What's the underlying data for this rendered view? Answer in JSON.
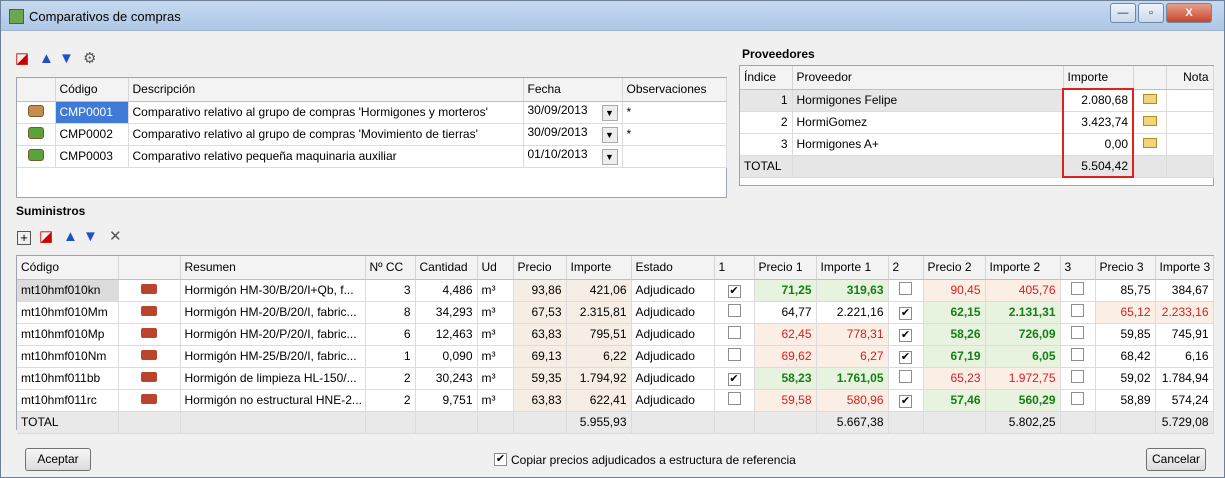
{
  "window": {
    "title": "Comparativos de compras",
    "minimize": "—",
    "maximize": "▫",
    "close": "X"
  },
  "comparativos": {
    "headers": {
      "codigo": "Código",
      "descripcion": "Descripción",
      "fecha": "Fecha",
      "observaciones": "Observaciones"
    },
    "rows": [
      {
        "codigo": "CMP0001",
        "descripcion": "Comparativo relativo al grupo de compras 'Hormigones y morteros'",
        "fecha": "30/09/2013",
        "obs": "*"
      },
      {
        "codigo": "CMP0002",
        "descripcion": "Comparativo relativo al grupo de compras 'Movimiento de tierras'",
        "fecha": "30/09/2013",
        "obs": "*"
      },
      {
        "codigo": "CMP0003",
        "descripcion": "Comparativo relativo pequeña maquinaria auxiliar",
        "fecha": "01/10/2013",
        "obs": ""
      }
    ]
  },
  "proveedores": {
    "title": "Proveedores",
    "headers": {
      "indice": "Índice",
      "proveedor": "Proveedor",
      "importe": "Importe",
      "nota": "Nota"
    },
    "rows": [
      {
        "indice": "1",
        "proveedor": "Hormigones Felipe",
        "importe": "2.080,68"
      },
      {
        "indice": "2",
        "proveedor": "HormiGomez",
        "importe": "3.423,74"
      },
      {
        "indice": "3",
        "proveedor": "Hormigones A+",
        "importe": "0,00"
      }
    ],
    "total_label": "TOTAL",
    "total": "5.504,42"
  },
  "suministros": {
    "title": "Suministros",
    "headers": {
      "codigo": "Código",
      "resumen": "Resumen",
      "ncc": "Nº CC",
      "cantidad": "Cantidad",
      "ud": "Ud",
      "precio": "Precio",
      "importe": "Importe",
      "estado": "Estado",
      "c1": "1",
      "p1": "Precio 1",
      "i1": "Importe 1",
      "c2": "2",
      "p2": "Precio 2",
      "i2": "Importe 2",
      "c3": "3",
      "p3": "Precio 3",
      "i3": "Importe 3"
    },
    "rows": [
      {
        "codigo": "mt10hmf010kn",
        "resumen": "Hormigón HM-30/B/20/I+Qb, f...",
        "ncc": "3",
        "cantidad": "4,486",
        "ud": "m³",
        "precio": "93,86",
        "importe": "421,06",
        "estado": "Adjudicado",
        "c1": "✔",
        "p1": "71,25",
        "i1": "319,63",
        "c2": "",
        "p2": "90,45",
        "i2": "405,76",
        "c3": "",
        "p3": "85,75",
        "i3": "384,67"
      },
      {
        "codigo": "mt10hmf010Mm",
        "resumen": "Hormigón HM-20/B/20/I, fabric...",
        "ncc": "8",
        "cantidad": "34,293",
        "ud": "m³",
        "precio": "67,53",
        "importe": "2.315,81",
        "estado": "Adjudicado",
        "c1": "",
        "p1": "64,77",
        "i1": "2.221,16",
        "c2": "✔",
        "p2": "62,15",
        "i2": "2.131,31",
        "c3": "",
        "p3": "65,12",
        "i3": "2.233,16"
      },
      {
        "codigo": "mt10hmf010Mp",
        "resumen": "Hormigón HM-20/P/20/I, fabric...",
        "ncc": "6",
        "cantidad": "12,463",
        "ud": "m³",
        "precio": "63,83",
        "importe": "795,51",
        "estado": "Adjudicado",
        "c1": "",
        "p1": "62,45",
        "i1": "778,31",
        "c2": "✔",
        "p2": "58,26",
        "i2": "726,09",
        "c3": "",
        "p3": "59,85",
        "i3": "745,91"
      },
      {
        "codigo": "mt10hmf010Nm",
        "resumen": "Hormigón HM-25/B/20/I, fabric...",
        "ncc": "1",
        "cantidad": "0,090",
        "ud": "m³",
        "precio": "69,13",
        "importe": "6,22",
        "estado": "Adjudicado",
        "c1": "",
        "p1": "69,62",
        "i1": "6,27",
        "c2": "✔",
        "p2": "67,19",
        "i2": "6,05",
        "c3": "",
        "p3": "68,42",
        "i3": "6,16"
      },
      {
        "codigo": "mt10hmf011bb",
        "resumen": "Hormigón de limpieza HL-150/...",
        "ncc": "2",
        "cantidad": "30,243",
        "ud": "m³",
        "precio": "59,35",
        "importe": "1.794,92",
        "estado": "Adjudicado",
        "c1": "✔",
        "p1": "58,23",
        "i1": "1.761,05",
        "c2": "",
        "p2": "65,23",
        "i2": "1.972,75",
        "c3": "",
        "p3": "59,02",
        "i3": "1.784,94"
      },
      {
        "codigo": "mt10hmf011rc",
        "resumen": "Hormigón no estructural HNE-2...",
        "ncc": "2",
        "cantidad": "9,751",
        "ud": "m³",
        "precio": "63,83",
        "importe": "622,41",
        "estado": "Adjudicado",
        "c1": "",
        "p1": "59,58",
        "i1": "580,96",
        "c2": "✔",
        "p2": "57,46",
        "i2": "560,29",
        "c3": "",
        "p3": "58,89",
        "i3": "574,24"
      }
    ],
    "total": {
      "label": "TOTAL",
      "importe": "5.955,93",
      "i1": "5.667,38",
      "i2": "5.802,25",
      "i3": "5.729,08"
    }
  },
  "footer": {
    "aceptar": "Aceptar",
    "copiar_label": "Copiar precios adjudicados a estructura de referencia",
    "copiar_checked": "✔",
    "cancelar": "Cancelar"
  }
}
